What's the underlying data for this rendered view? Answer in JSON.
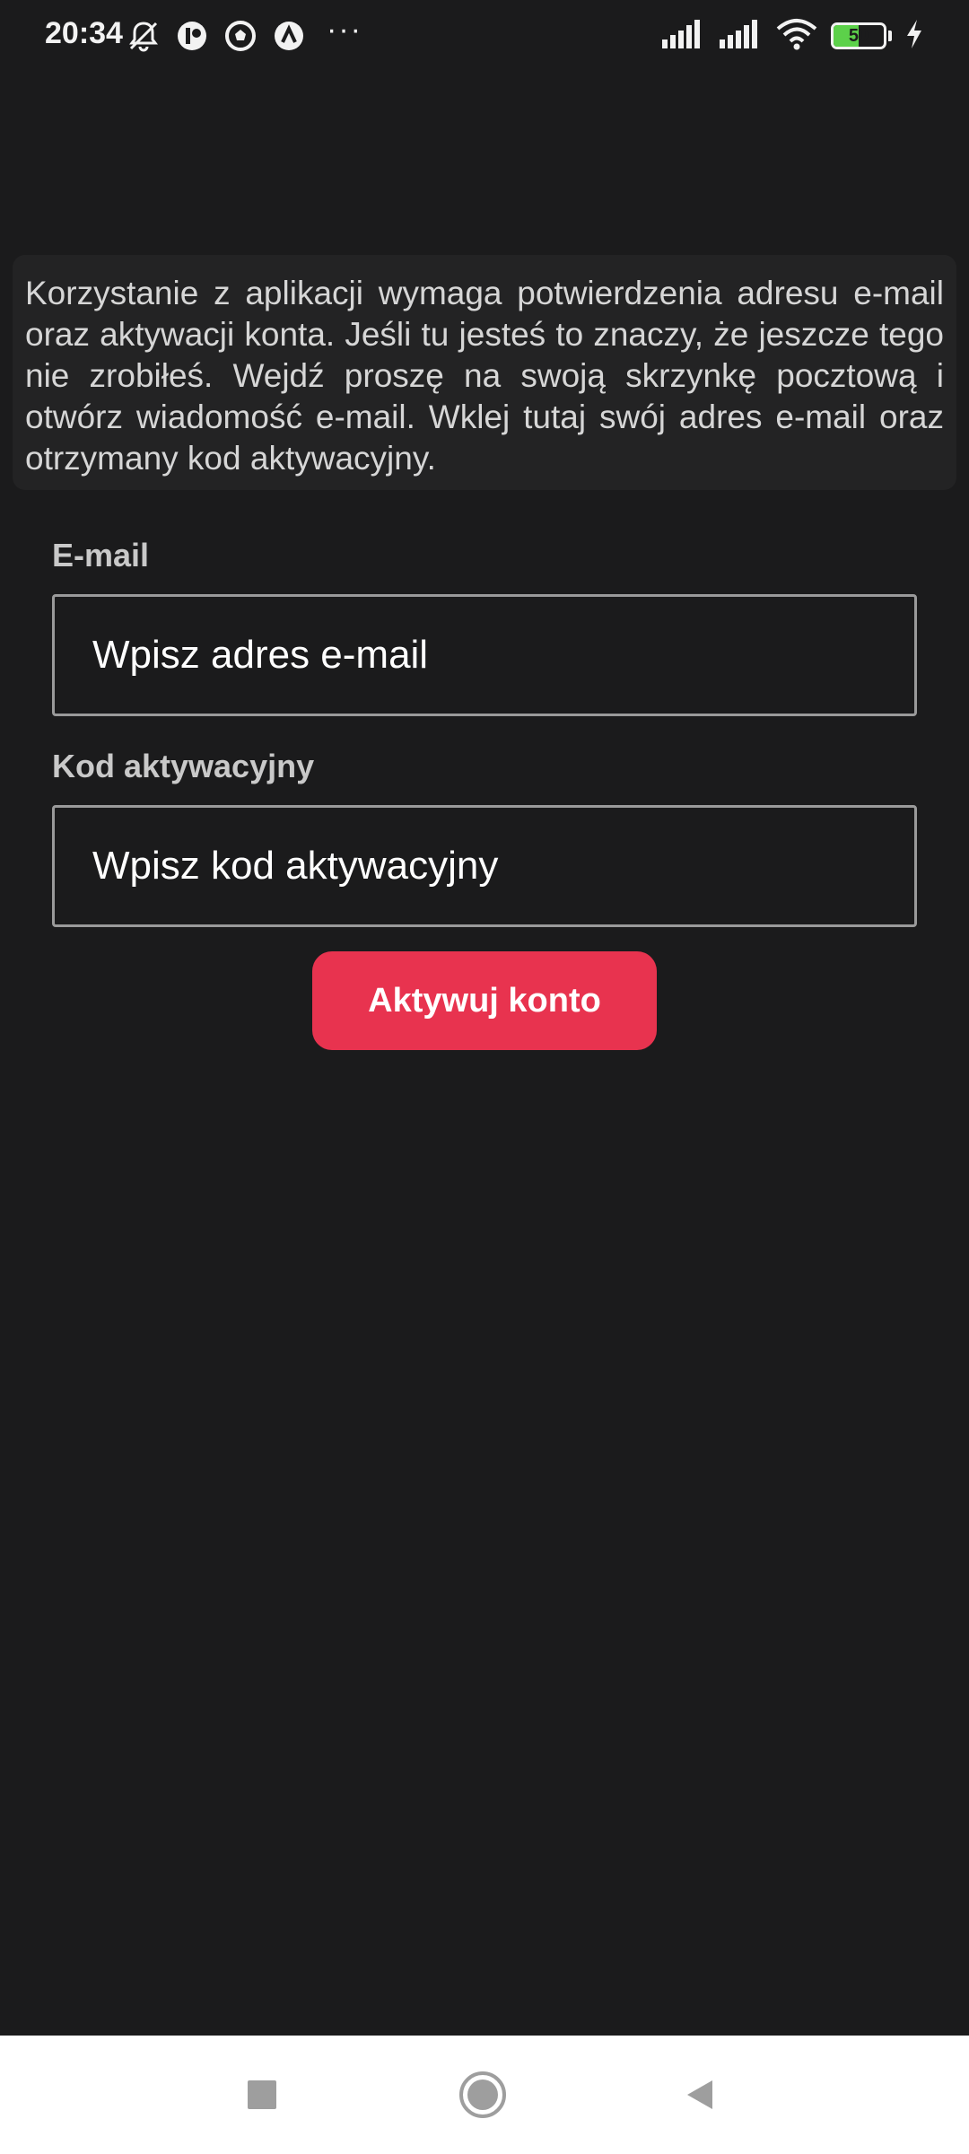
{
  "status_bar": {
    "time": "20:34",
    "battery_level": "50",
    "battery_fraction": 0.5,
    "left_icons": [
      "mute-bell-icon",
      "app-notification-icon",
      "football-app-icon",
      "assistant-icon",
      "more-dots-icon"
    ],
    "right_icons": [
      "signal-icon",
      "signal-icon",
      "wifi-icon",
      "battery-icon",
      "charging-icon"
    ],
    "more_dots": "···"
  },
  "info": {
    "text": "Korzystanie z aplikacji wymaga potwierdzenia adresu e-mail oraz aktywacji konta. Jeśli tu jesteś to znaczy, że jeszcze tego nie zrobiłeś. Wejdź proszę na swoją skrzynkę pocztową i otwórz wiadomość e-mail. Wklej tutaj swój adres e-mail oraz otrzymany kod aktywacyjny."
  },
  "form": {
    "email": {
      "label": "E-mail",
      "value": "",
      "placeholder": "Wpisz adres e-mail"
    },
    "code": {
      "label": "Kod aktywacyjny",
      "value": "",
      "placeholder": "Wpisz kod aktywacyjny"
    },
    "submit_label": "Aktywuj konto"
  },
  "colors": {
    "background": "#1b1b1c",
    "accent": "#e8334f",
    "battery": "#5cd14a"
  },
  "nav_bar": {
    "icons": [
      "recents-square-icon",
      "home-circle-icon",
      "back-triangle-icon"
    ]
  }
}
